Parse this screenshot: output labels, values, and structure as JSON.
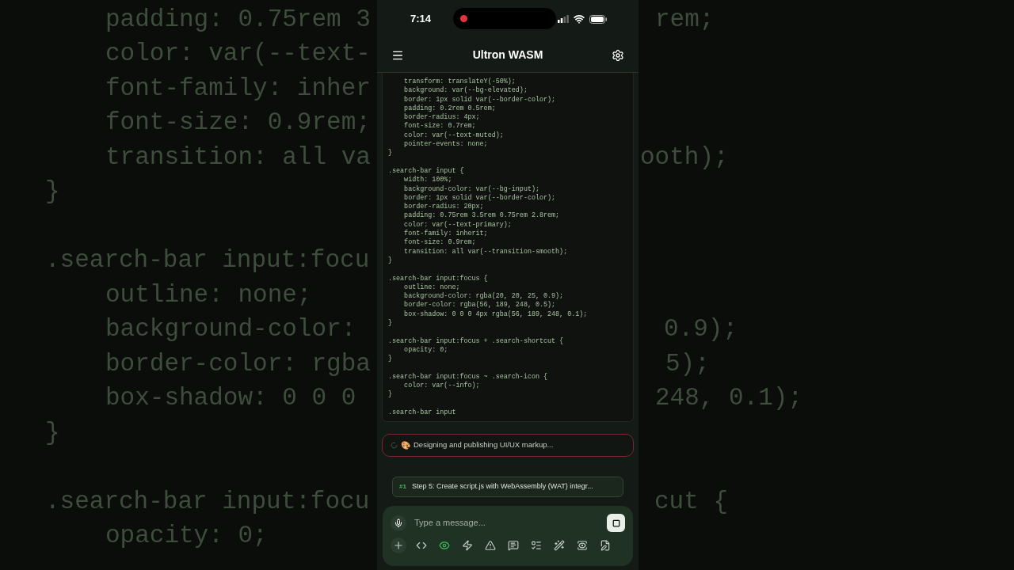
{
  "backdrop": {
    "rows": [
      {
        "kind": "indent",
        "left": "padding: 0.75rem 3",
        "right": "rem;"
      },
      {
        "kind": "indent",
        "left": "color: var(--text-"
      },
      {
        "kind": "indent",
        "left": "font-family: inher"
      },
      {
        "kind": "indent",
        "left": "font-size: 0.9rem;"
      },
      {
        "kind": "indent",
        "left": "transition: all va",
        "right": "ooth);"
      },
      {
        "kind": "top",
        "left": "}"
      },
      {
        "kind": "gap"
      },
      {
        "kind": "top",
        "left": ".search-bar input:focu"
      },
      {
        "kind": "indent",
        "left": "outline: none;"
      },
      {
        "kind": "indent",
        "left": "background-color: ",
        "right": "0.9);"
      },
      {
        "kind": "indent",
        "left": "border-color: rgba",
        "right": "5);"
      },
      {
        "kind": "indent",
        "left": "box-shadow: 0 0 0 ",
        "right": "248, 0.1);"
      },
      {
        "kind": "top",
        "left": "}"
      },
      {
        "kind": "gap"
      },
      {
        "kind": "top",
        "left": ".search-bar input:focu",
        "right": "cut {"
      },
      {
        "kind": "indent",
        "left": "opacity: 0;"
      }
    ]
  },
  "phone": {
    "status_bar": {
      "time": "7:14",
      "recording": true
    },
    "header": {
      "title": "Ultron WASM"
    },
    "code_blocks": [
      [
        "    transform: translateY(-50%);",
        "    background: var(--bg-elevated);",
        "    border: 1px solid var(--border-color);",
        "    padding: 0.2rem 0.5rem;",
        "    border-radius: 4px;",
        "    font-size: 0.7rem;",
        "    color: var(--text-muted);",
        "    pointer-events: none;",
        "}"
      ],
      [
        ".search-bar input {",
        "    width: 100%;",
        "    background-color: var(--bg-input);",
        "    border: 1px solid var(--border-color);",
        "    border-radius: 20px;",
        "    padding: 0.75rem 3.5rem 0.75rem 2.8rem;",
        "    color: var(--text-primary);",
        "    font-family: inherit;",
        "    font-size: 0.9rem;",
        "    transition: all var(--transition-smooth);",
        "}"
      ],
      [
        ".search-bar input:focus {",
        "    outline: none;",
        "    background-color: rgba(20, 20, 25, 0.9);",
        "    border-color: rgba(56, 189, 248, 0.5);",
        "    box-shadow: 0 0 0 4px rgba(56, 189, 248, 0.1);",
        "}"
      ],
      [
        ".search-bar input:focus + .search-shortcut {",
        "    opacity: 0;",
        "}"
      ],
      [
        ".search-bar input:focus ~ .search-icon {",
        "    color: var(--info);",
        "}"
      ],
      [
        ".search-bar input"
      ]
    ],
    "status": {
      "emoji": "🎨",
      "text": "Designing and publishing UI/UX markup..."
    },
    "step": {
      "number": "#1",
      "text": "Step 5: Create script.js with WebAssembly (WAT) integr..."
    },
    "composer": {
      "placeholder": "Type a message...",
      "tools": [
        {
          "on": false
        },
        {
          "on": false
        },
        {
          "on": true
        },
        {
          "on": false
        },
        {
          "on": false
        },
        {
          "on": false
        },
        {
          "on": false
        },
        {
          "on": false
        },
        {
          "on": false
        },
        {
          "on": false
        }
      ]
    }
  }
}
